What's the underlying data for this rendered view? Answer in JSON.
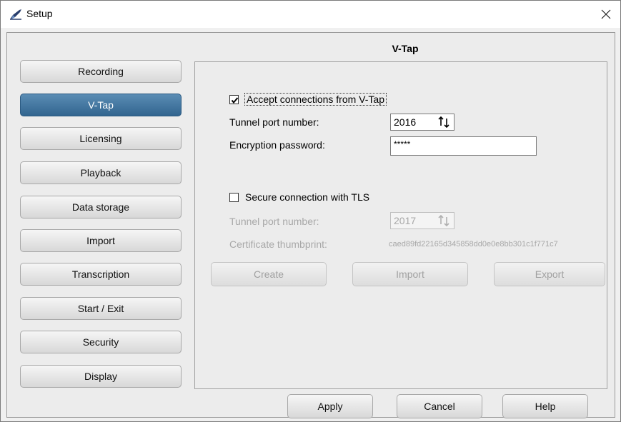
{
  "window": {
    "title": "Setup",
    "close_glyph": "✕"
  },
  "sidebar": {
    "items": [
      {
        "label": "Recording",
        "active": false
      },
      {
        "label": "V-Tap",
        "active": true
      },
      {
        "label": "Licensing",
        "active": false
      },
      {
        "label": "Playback",
        "active": false
      },
      {
        "label": "Data storage",
        "active": false
      },
      {
        "label": "Import",
        "active": false
      },
      {
        "label": "Transcription",
        "active": false
      },
      {
        "label": "Start / Exit",
        "active": false
      },
      {
        "label": "Security",
        "active": false
      },
      {
        "label": "Display",
        "active": false
      }
    ]
  },
  "section": {
    "title": "V-Tap"
  },
  "vtap": {
    "accept_label": "Accept connections from V-Tap",
    "accept_checked": true,
    "tunnel_port_label": "Tunnel port number:",
    "tunnel_port_value": "2016",
    "encryption_label": "Encryption password:",
    "encryption_value": "*****"
  },
  "tls": {
    "secure_label": "Secure connection with TLS",
    "secure_checked": false,
    "tunnel_port_label": "Tunnel port number:",
    "tunnel_port_value": "2017",
    "thumbprint_label": "Certificate thumbprint:",
    "thumbprint_value": "caed89fd22165d345858dd0e0e8bb301c1f771c7",
    "create_label": "Create",
    "import_label": "Import",
    "export_label": "Export"
  },
  "footer": {
    "apply_label": "Apply",
    "cancel_label": "Cancel",
    "help_label": "Help"
  },
  "colors": {
    "active_nav": "#3a6d97",
    "disabled_text": "#a8a8a8",
    "panel_bg": "#ececec"
  }
}
